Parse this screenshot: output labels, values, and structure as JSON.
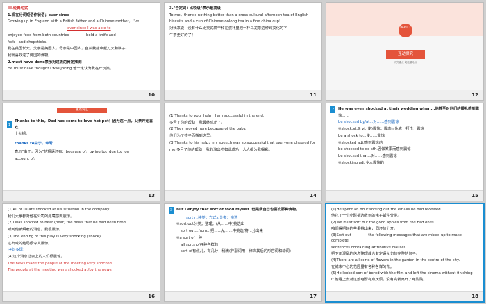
{
  "slides": [
    {
      "num": "10",
      "lines": [
        "III.经典句式",
        "1.现在分词短语作状语；ever since",
        "Growing up in England with a British father and a Chinese mother，I've",
        "ever since I was able to",
        "enjoyed food from both countries ________ hold a knife and",
        "fork—and chopsticks.",
        "我在英国长大，父亲是英国人，母亲是中国人，自从我能拿起刀叉和筷子，",
        "我就喜欢这了两国的食物。",
        "2.must have done表示对过去的肯定推测",
        "He must have thought I was joking.他一定认为我在开玩笑。"
      ]
    },
    {
      "num": "11",
      "lines": [
        "3.\"否定词+比较级\"表示最高级",
        "To me，there's nothing better than a cross-cultural afternoon tea of English",
        "biscuits and a cup of Chinese oolong tea in a fine china cup!",
        "对我来说，没有什么比英式饼干和在瓷杯里泡一杯乌龙茶这种跨文化的下",
        "午茶更好的了！"
      ]
    },
    {
      "num": "12",
      "part": "PART 2",
      "title": "互动探究",
      "sub": "研究重点 突破重难点"
    },
    {
      "num": "13",
      "tag": "重点词汇",
      "lines": [
        "Thanks to this，Dad has come to love hot pot！因为这一点，父亲开始喜欢",
        "上火锅。",
        "thanks to由于，幸亏",
        "表示\"由于，因为\"的短语还有：because of，owing to，due to，on",
        "account of。"
      ]
    },
    {
      "num": "14",
      "lines": [
        "(1)Thanks to your help，I am successful in the end.",
        "多亏了你的帮助，我最终成功了。",
        "(2)They moved here because of the baby.",
        "他们为了孩子而搬到这里。",
        "(3)Thanks to his help，my speech was so successful that everyone cheered for",
        "me.多亏了他的帮助，我的演出才如此成功，人人都为我喝彩。"
      ]
    },
    {
      "num": "15",
      "lines": [
        "He was even shocked at their wedding when...他甚至对他们的婚礼感到震",
        "惊……",
        "be shocked by/at...对……感到震惊",
        "※shock.vt.& vi.(使)震惊；震动n.休克；打击；震惊",
        "be a shock to...使……震惊",
        "※shocked adj.感到震惊的",
        "be shocked to do sth.因做某事而感到震惊",
        "be shocked that...对……感到震惊",
        "※shocking adj.令人震惊的"
      ]
    },
    {
      "num": "16",
      "lines": [
        "(1)All of us are shocked at his situation in the company.",
        "我们大家都对他在公司的处境感到震惊。",
        "(2)I was shocked to hear (hear) the news that he had been fired.",
        "听到他被解雇的消息，我很震惊。",
        "(3)The ending of this play is very shocking (shock).",
        "这出戏的结局很令人震惊。",
        "Ⅰ→句多译：",
        "(4)这个消息让会上的人们很震惊。",
        "The news made the people at the meeting very shocked",
        "The people at the meeting were shocked at/by the news"
      ]
    },
    {
      "num": "17",
      "lines": [
        "But I enjoy that sort of food myself. 但是我自己也喜欢那种食物。",
        "sort n.种类；方式v.分类；挑选",
        "※sort out分类；整理；(从……中)挑选出",
        "sort out...from...把……从……中挑选/将...分出来",
        "※a sort of一种",
        "all sorts of各种各样的",
        "sort of有点儿，有几分；稍微(作副词用，修饰其后的形容词和动词)"
      ]
    },
    {
      "num": "18",
      "lines": [
        "(1)He spent an hour sorting out the emails he had received.",
        "他花了一个小时挑选收到的电子邮件分类。",
        "(2)We must sort out the good apples from the bad ones.",
        "咱们得把好的苹果挑出来，同坏的分开。",
        "(3)Sort out ________ the following messages that are mixed up to make complete",
        "sentences containing attributive clauses.",
        "把下面混乱的信息整理成含有定语从句的完整的句子。",
        "(4)There are all sorts of flowers in the garden in the centre of the city.",
        "在城市中心的花园里有各种各样的花。",
        "(5)He looked sort of bored with the film and left the cinema without finishing",
        "it.他看上去对这部电影有点厌烦，没有完就离开了电影院。"
      ]
    }
  ]
}
